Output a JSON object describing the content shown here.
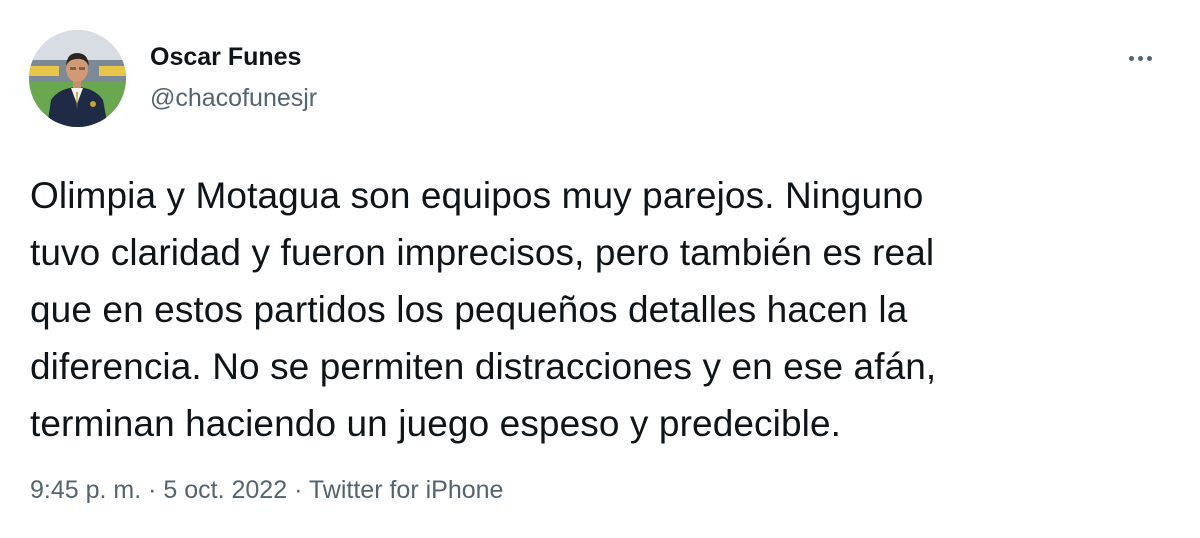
{
  "author": {
    "display_name": "Oscar Funes",
    "handle": "@chacofunesjr"
  },
  "tweet": {
    "lines": [
      "Olimpia y Motagua son equipos muy parejos. Ninguno",
      "tuvo claridad y fueron imprecisos, pero también es real",
      "que en estos partidos los pequeños detalles hacen la",
      "diferencia. No se permiten distracciones y en ese afán,",
      "terminan haciendo un juego espeso y predecible."
    ]
  },
  "meta": {
    "time": "9:45 p. m.",
    "separator": "·",
    "date": "5 oct. 2022",
    "source": "Twitter for iPhone"
  },
  "icons": {
    "more": "more-horizontal-icon"
  },
  "colors": {
    "text_primary": "#0f1419",
    "text_secondary": "#536471",
    "background": "#ffffff"
  }
}
